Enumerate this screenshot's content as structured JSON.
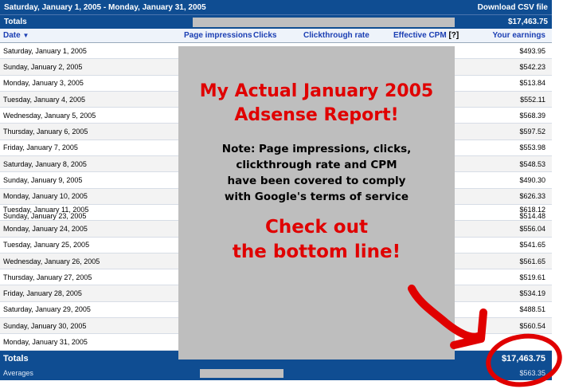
{
  "report": {
    "date_range": "Saturday, January 1, 2005 - Monday, January 31, 2005",
    "download_label": "Download CSV file",
    "totals_label": "Totals",
    "totals_value": "$17,463.75",
    "columns": {
      "date": "Date",
      "impressions": "Page impressions",
      "clicks": "Clicks",
      "ctr": "Clickthrough rate",
      "cpm": "Effective CPM",
      "cpm_help": "[?]",
      "earnings": "Your earnings"
    },
    "rows": [
      {
        "date": "Saturday, January 1, 2005",
        "earnings": "$493.95"
      },
      {
        "date": "Sunday, January 2, 2005",
        "earnings": "$542.23"
      },
      {
        "date": "Monday, January 3, 2005",
        "earnings": "$513.84"
      },
      {
        "date": "Tuesday, January 4, 2005",
        "earnings": "$552.11"
      },
      {
        "date": "Wednesday, January 5, 2005",
        "earnings": "$568.39"
      },
      {
        "date": "Thursday, January 6, 2005",
        "earnings": "$597.52"
      },
      {
        "date": "Friday, January 7, 2005",
        "earnings": "$553.98"
      },
      {
        "date": "Saturday, January 8, 2005",
        "earnings": "$548.53"
      },
      {
        "date": "Sunday, January 9, 2005",
        "earnings": "$490.30"
      },
      {
        "date": "Monday, January 10, 2005",
        "earnings": "$626.33"
      },
      {
        "date": "Tuesday, January 11, 2005",
        "earnings": "$618.12"
      },
      {
        "date": "Monday, January 24, 2005",
        "earnings": "$556.04"
      },
      {
        "date": "Tuesday, January 25, 2005",
        "earnings": "$541.65"
      },
      {
        "date": "Wednesday, January 26, 2005",
        "earnings": "$561.65"
      },
      {
        "date": "Thursday, January 27, 2005",
        "earnings": "$519.61"
      },
      {
        "date": "Friday, January 28, 2005",
        "earnings": "$534.19"
      },
      {
        "date": "Saturday, January 29, 2005",
        "earnings": "$488.51"
      },
      {
        "date": "Sunday, January 30, 2005",
        "earnings": "$560.54"
      },
      {
        "date": "Monday, January 31, 2005",
        "earnings": ""
      }
    ],
    "splice_row": {
      "date": "Sunday, January 23, 2005",
      "earnings": "$514.48"
    },
    "footer_totals_label": "Totals",
    "footer_totals_value": "$17,463.75",
    "averages_label": "Averages",
    "averages_value": "$563.35"
  },
  "overlay": {
    "title_line1": "My Actual January 2005",
    "title_line2": "Adsense Report!",
    "note_line1": "Note: Page impressions, clicks,",
    "note_line2": "clickthrough rate and CPM",
    "note_line3": "have been covered to comply",
    "note_line4": "with Google's terms of service",
    "cta_line1": "Check out",
    "cta_line2": "the bottom line!"
  },
  "colors": {
    "header_blue": "#0f4d92",
    "link_blue": "#1a3eb3",
    "annotation_red": "#e00000",
    "overlay_grey": "#bebebe"
  }
}
